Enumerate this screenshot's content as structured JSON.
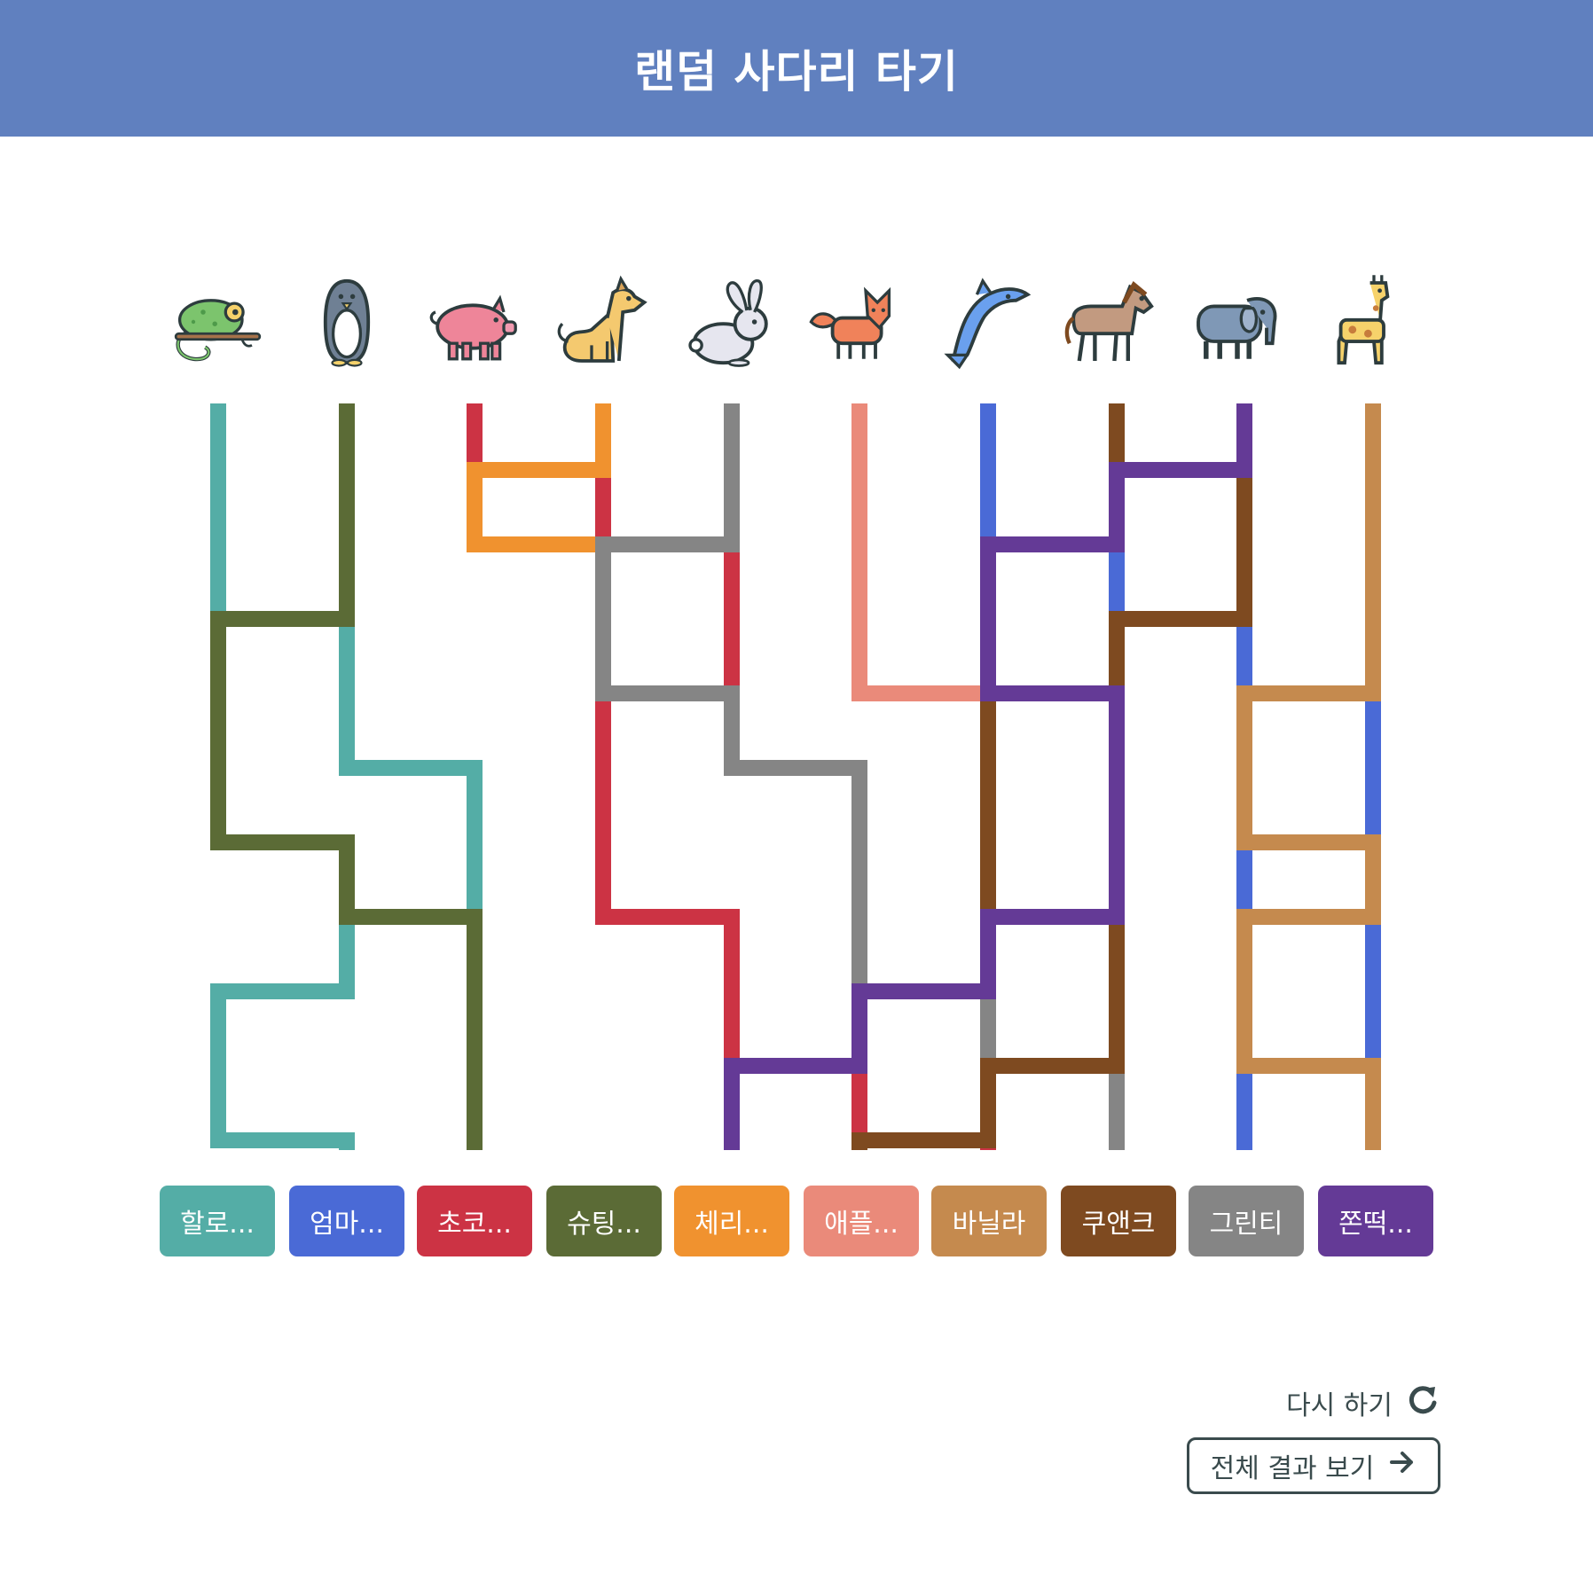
{
  "header": {
    "title": "랜덤 사다리 타기"
  },
  "animals": [
    {
      "name": "chameleon-icon"
    },
    {
      "name": "penguin-icon"
    },
    {
      "name": "pig-icon"
    },
    {
      "name": "dog-icon"
    },
    {
      "name": "rabbit-icon"
    },
    {
      "name": "fox-icon"
    },
    {
      "name": "dolphin-icon"
    },
    {
      "name": "horse-icon"
    },
    {
      "name": "elephant-icon"
    },
    {
      "name": "giraffe-icon"
    }
  ],
  "start_colors": [
    "#54ada6",
    "#5b6b36",
    "#cc3344",
    "#f0922f",
    "#858585",
    "#ea8a7a",
    "#4a6ad6",
    "#7e4a20",
    "#643a96",
    "#c58a4e"
  ],
  "results": [
    {
      "label": "할로...",
      "color": "#54ada6"
    },
    {
      "label": "엄마...",
      "color": "#4a6ad6"
    },
    {
      "label": "초코...",
      "color": "#cc3344"
    },
    {
      "label": "슈팅...",
      "color": "#5b6b36"
    },
    {
      "label": "체리...",
      "color": "#f0922f"
    },
    {
      "label": "애플...",
      "color": "#ea8a7a"
    },
    {
      "label": "바닐라",
      "color": "#c58a4e"
    },
    {
      "label": "쿠앤크",
      "color": "#7e4a20"
    },
    {
      "label": "그린티",
      "color": "#858585"
    },
    {
      "label": "쫀떡...",
      "color": "#643a96"
    }
  ],
  "ladder": {
    "levels": 10,
    "rungs": [
      [
        0,
        [
          2,
          7
        ]
      ],
      [
        1,
        [
          2,
          3,
          6
        ]
      ],
      [
        2,
        [
          0,
          7
        ]
      ],
      [
        3,
        [
          2,
          3,
          5,
          6,
          8
        ]
      ],
      [
        4,
        [
          1,
          4
        ]
      ],
      [
        5,
        [
          0,
          8
        ]
      ],
      [
        6,
        [
          1,
          3,
          6,
          8
        ]
      ],
      [
        7,
        [
          0,
          5
        ]
      ],
      [
        8,
        [
          4,
          6,
          8
        ]
      ],
      [
        9,
        [
          0,
          5
        ]
      ]
    ]
  },
  "controls": {
    "retry_label": "다시 하기",
    "view_all_label": "전체 결과 보기"
  }
}
